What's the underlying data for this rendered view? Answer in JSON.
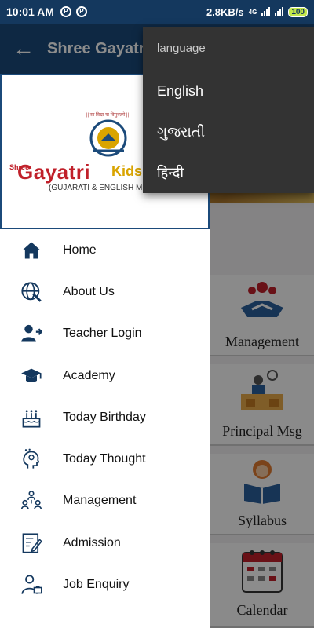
{
  "status_bar": {
    "time": "10:01 AM",
    "notif_icons": [
      "P",
      "P"
    ],
    "speed": "2.8KB/s",
    "network_type": "4G",
    "battery": "100"
  },
  "app_bar": {
    "title": "Shree Gayatri"
  },
  "drawer": {
    "logo": {
      "motto": "|| सा विद्या या विमुक्तये ||",
      "shree": "Shree",
      "gayatri": "Gayatri",
      "kids": "Kids",
      "subtitle": "(GUJARATI & ENGLISH ME"
    },
    "items": [
      {
        "label": "Home",
        "icon": "home-icon"
      },
      {
        "label": "About Us",
        "icon": "globe-icon"
      },
      {
        "label": "Teacher Login",
        "icon": "user-login-icon"
      },
      {
        "label": "Academy",
        "icon": "graduation-cap-icon"
      },
      {
        "label": "Today Birthday",
        "icon": "birthday-cake-icon"
      },
      {
        "label": "Today Thought",
        "icon": "thought-head-icon"
      },
      {
        "label": "Management",
        "icon": "team-icon"
      },
      {
        "label": "Admission",
        "icon": "admission-form-icon"
      },
      {
        "label": "Job Enquiry",
        "icon": "job-enquiry-icon"
      }
    ]
  },
  "background_tiles": [
    {
      "label": "Management",
      "icon": "handshake-icon"
    },
    {
      "label": "Principal Msg",
      "icon": "principal-desk-icon"
    },
    {
      "label": "Syllabus",
      "icon": "reading-icon"
    },
    {
      "label": "Calendar",
      "icon": "calendar-icon"
    }
  ],
  "language_menu": {
    "title": "language",
    "options": [
      "English",
      "ગુજરાતી",
      "हिन्दी"
    ]
  },
  "colors": {
    "status_bar": "#14385e",
    "app_bar": "#1b4a7a",
    "menu_bg": "#333333",
    "brand_red": "#c0202a"
  }
}
